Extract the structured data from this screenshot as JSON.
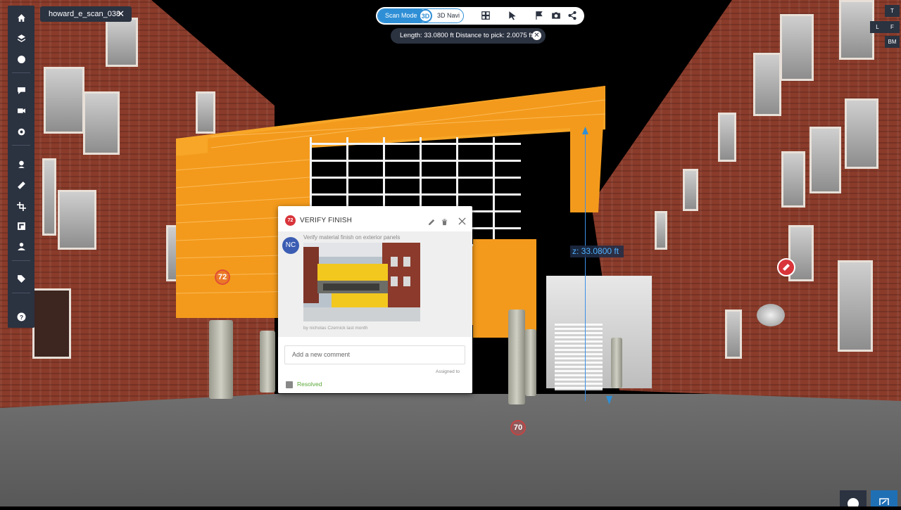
{
  "scan_tab": {
    "name": "howard_e_scan_038",
    "close": "✕"
  },
  "toolbar": {
    "scan_mode_label": "Scan Mode",
    "navi_label": "3D Navi",
    "knob_glyph": "3D",
    "icons": [
      "grid-icon",
      "cursor-icon",
      "flag-icon",
      "camera-icon",
      "share-icon"
    ]
  },
  "measurement": {
    "text": "Length: 33.0800 ft Distance to pick: 2.0075 ft",
    "close": "✕"
  },
  "dimension": {
    "z_label": "z: 33.0800 ft"
  },
  "view_cube": {
    "top": "T",
    "left": "L",
    "front": "F",
    "bm": "BM"
  },
  "sidebar": {
    "icons": [
      "home-icon",
      "layers-icon",
      "sphere-icon",
      "comment-icon",
      "camera-icon",
      "settings-icon",
      "pin-icon",
      "ruler-icon",
      "crop-icon",
      "floorplan-icon",
      "person-icon",
      "tag-icon",
      "help-icon"
    ]
  },
  "issue_card": {
    "badge": "72",
    "title": "VERIFY FINISH",
    "avatar": "NC",
    "comment": "Verify material finish on exterior panels",
    "meta": "by nicholas Czernick last month",
    "input_placeholder": "Add a new comment",
    "assigned_label": "Assigned to",
    "resolved_label": "Resolved"
  },
  "markers": {
    "left": "72",
    "bottom": "70"
  },
  "colors": {
    "panel": "#2b3240",
    "accent": "#2f8fd6",
    "orange": "#f39a1c",
    "issue": "#d8343a",
    "resolved": "#5aa838"
  }
}
